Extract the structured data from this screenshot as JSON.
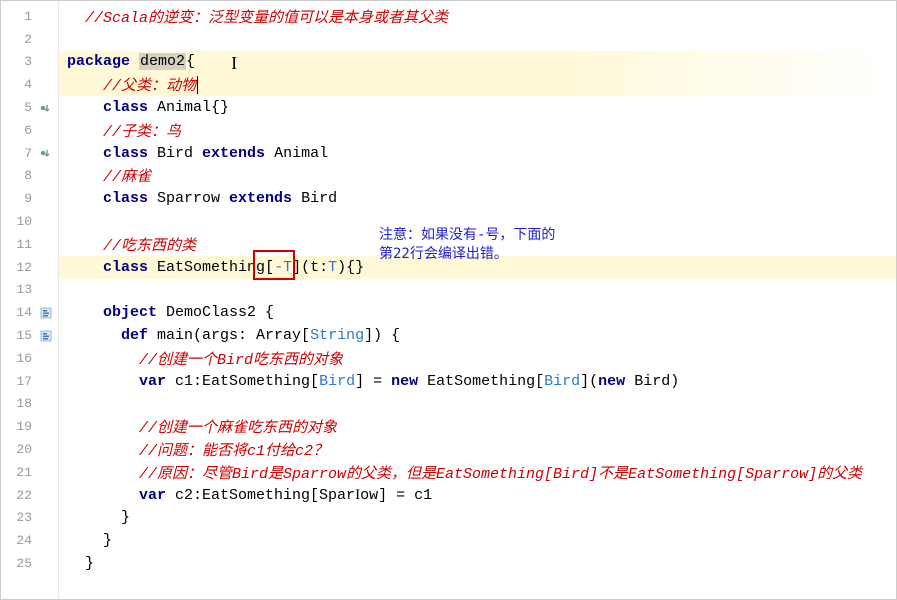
{
  "gutter": {
    "lines": [
      {
        "n": "1",
        "marker": ""
      },
      {
        "n": "2",
        "marker": ""
      },
      {
        "n": "3",
        "marker": ""
      },
      {
        "n": "4",
        "marker": ""
      },
      {
        "n": "5",
        "marker": "impl"
      },
      {
        "n": "6",
        "marker": ""
      },
      {
        "n": "7",
        "marker": "impl"
      },
      {
        "n": "8",
        "marker": ""
      },
      {
        "n": "9",
        "marker": ""
      },
      {
        "n": "10",
        "marker": ""
      },
      {
        "n": "11",
        "marker": ""
      },
      {
        "n": "12",
        "marker": ""
      },
      {
        "n": "13",
        "marker": ""
      },
      {
        "n": "14",
        "marker": "fold"
      },
      {
        "n": "15",
        "marker": "fold"
      },
      {
        "n": "16",
        "marker": ""
      },
      {
        "n": "17",
        "marker": ""
      },
      {
        "n": "18",
        "marker": ""
      },
      {
        "n": "19",
        "marker": ""
      },
      {
        "n": "20",
        "marker": ""
      },
      {
        "n": "21",
        "marker": ""
      },
      {
        "n": "22",
        "marker": ""
      },
      {
        "n": "23",
        "marker": ""
      },
      {
        "n": "24",
        "marker": ""
      },
      {
        "n": "25",
        "marker": ""
      }
    ]
  },
  "code": {
    "l1_comment": "//Scala的逆变：泛型变量的值可以是本身或者其父类",
    "l3_kw": "package",
    "l3_ident": "demo2",
    "l3_brace": "{",
    "l4_comment": "//父类：动物",
    "l5_kw": "class",
    "l5_ident": " Animal{}",
    "l6_comment": "//子类：鸟",
    "l7_kw1": "class",
    "l7_ident1": " Bird ",
    "l7_kw2": "extends",
    "l7_ident2": " Animal",
    "l8_comment": "//麻雀",
    "l9_kw1": "class",
    "l9_ident1": " Sparrow ",
    "l9_kw2": "extends",
    "l9_ident2": " Bird",
    "l11_comment": "//吃东西的类",
    "l12_kw": "class",
    "l12_ident": " EatSomething",
    "l12_br1": "[",
    "l12_tparam": "-T",
    "l12_br2": "]",
    "l12_paren1": "(t:",
    "l12_ttype": "T",
    "l12_paren2": "){}",
    "l14_kw": "object",
    "l14_ident": " DemoClass2 {",
    "l15_kw": "def",
    "l15_ident1": " main(args: Array[",
    "l15_type": "String",
    "l15_ident2": "]) {",
    "l16_comment": "//创建一个Bird吃东西的对象",
    "l17_kw1": "var",
    "l17_ident1": " c1:EatSomething[",
    "l17_type1": "Bird",
    "l17_ident2": "] = ",
    "l17_kw2": "new",
    "l17_ident3": " EatSomething[",
    "l17_type2": "Bird",
    "l17_ident4": "](",
    "l17_kw3": "new",
    "l17_ident5": " Bird)",
    "l19_comment": "//创建一个麻雀吃东西的对象",
    "l20_comment": "//问题：能否将c1付给c2？",
    "l21_comment": "//原因：尽管Bird是Sparrow的父类，但是EatSomething[Bird]不是EatSomething[Sparrow]的父类",
    "l22_kw": "var",
    "l22_ident1": " c2:EatSomething[Spar",
    "l22_ident1b": "ow] = c1",
    "l23_brace": "}",
    "l24_brace": "}",
    "l25_brace": "}"
  },
  "annotation": {
    "text": "注意：如果没有-号，下面的第22行会编译出错。"
  },
  "indents": {
    "i0": "",
    "i2": "  ",
    "i4": "    ",
    "i6": "      ",
    "i8": "        "
  }
}
